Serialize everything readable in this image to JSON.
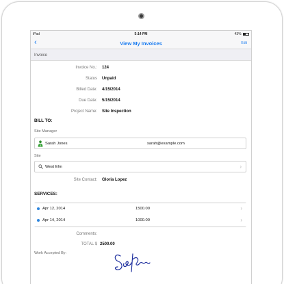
{
  "status_bar": {
    "carrier": "iPad",
    "time": "5:14 PM",
    "battery": "43%",
    "battery_level": 0.43
  },
  "nav": {
    "back_glyph": "‹",
    "title": "View My Invoices",
    "edit_label": "Edit"
  },
  "section_header": "Invoice",
  "invoice": {
    "number_label": "Invoice No.:",
    "number": "124",
    "status_label": "Status",
    "status": "Unpaid",
    "billed_label": "Billed Date:",
    "billed": "4/15/2014",
    "due_label": "Due Date:",
    "due": "5/15/2014",
    "project_label": "Project Name:",
    "project": "Site Inspection"
  },
  "bill_to": {
    "heading": "BILL TO:",
    "manager_label": "Site Manager",
    "manager_name": "Sarah Jones",
    "manager_email": "sarah@example.com",
    "site_label": "Site",
    "site_name": "West Elm",
    "contact_label": "Site Contact:",
    "contact_name": "Gloria Lopez"
  },
  "services": {
    "heading": "SERVICES:",
    "items": [
      {
        "date": "Apr 12, 2014",
        "amount": "1500.00"
      },
      {
        "date": "Apr 14, 2014",
        "amount": "1000.00"
      }
    ]
  },
  "comments_label": "Comments:",
  "total_label": "TOTAL $",
  "total_value": "2500.00",
  "accepted_label": "Work Accepted By:",
  "icons": {
    "back": "chevron-left-icon",
    "person": "person-money-icon",
    "search": "magnifier-icon",
    "row_chevron": "chevron-right-icon",
    "service_dot": "blue-dot-icon"
  },
  "colors": {
    "accent": "#1a7cf0",
    "dot": "#2e86de",
    "signature": "#1e2f9e"
  }
}
